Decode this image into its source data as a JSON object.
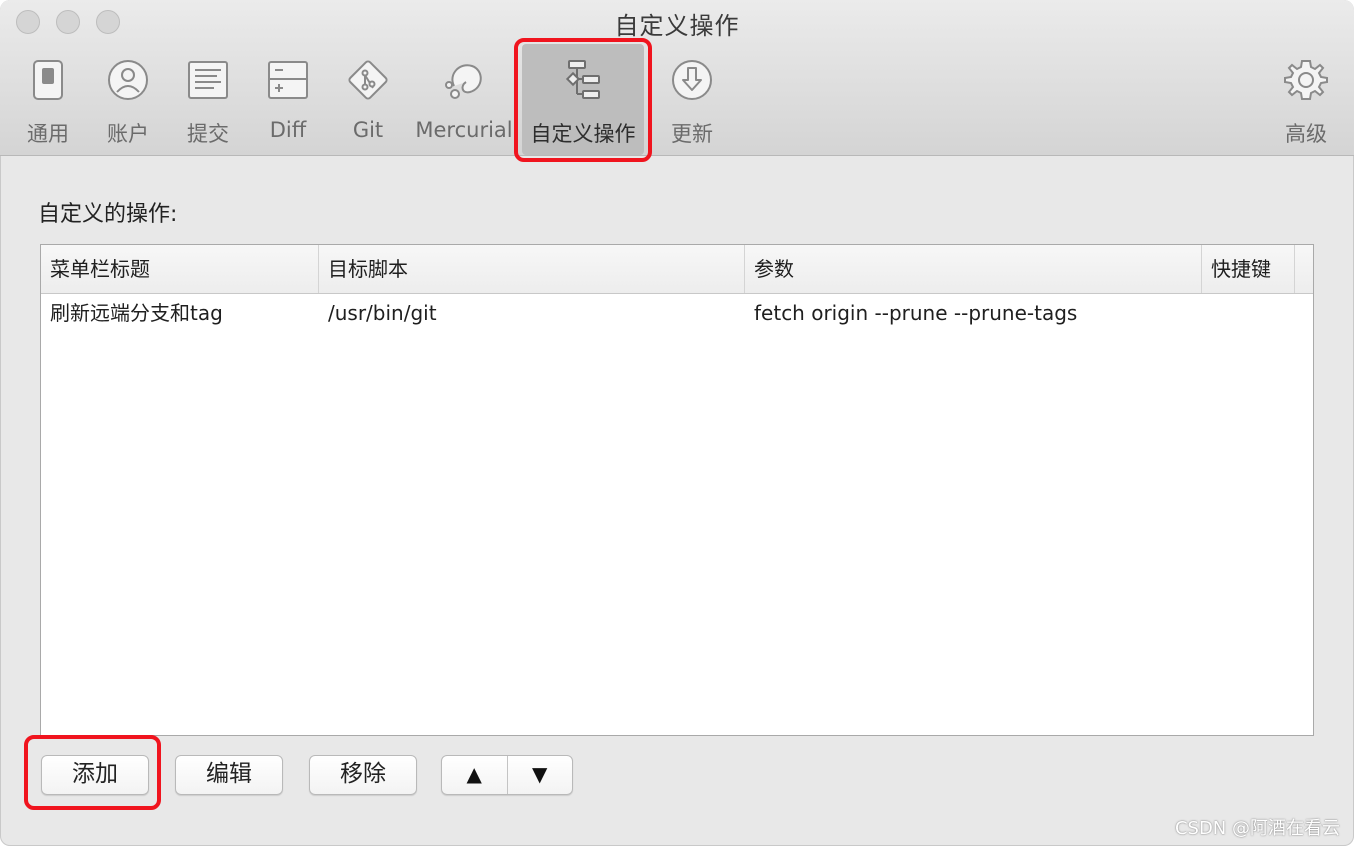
{
  "window": {
    "title": "自定义操作"
  },
  "toolbar": {
    "items": [
      {
        "label": "通用",
        "icon": "switch-icon"
      },
      {
        "label": "账户",
        "icon": "user-icon"
      },
      {
        "label": "提交",
        "icon": "document-lines-icon"
      },
      {
        "label": "Diff",
        "icon": "diff-icon"
      },
      {
        "label": "Git",
        "icon": "git-icon"
      },
      {
        "label": "Mercurial",
        "icon": "mercurial-icon"
      },
      {
        "label": "自定义操作",
        "icon": "custom-actions-icon",
        "selected": true
      },
      {
        "label": "更新",
        "icon": "download-arrow-icon"
      },
      {
        "label": "高级",
        "icon": "gear-icon"
      }
    ]
  },
  "content": {
    "section_label": "自定义的操作:",
    "table": {
      "columns": [
        "菜单栏标题",
        "目标脚本",
        "参数",
        "快捷键"
      ],
      "rows": [
        [
          "刷新远端分支和tag",
          "/usr/bin/git",
          "fetch origin --prune --prune-tags",
          ""
        ]
      ]
    },
    "buttons": {
      "add": "添加",
      "edit": "编辑",
      "remove": "移除",
      "move_up": "▲",
      "move_down": "▼"
    }
  },
  "watermark": "CSDN @阿酒在看云",
  "colors": {
    "highlight": "#f0141e",
    "selected_tab_bg": "#bdbdbd"
  }
}
